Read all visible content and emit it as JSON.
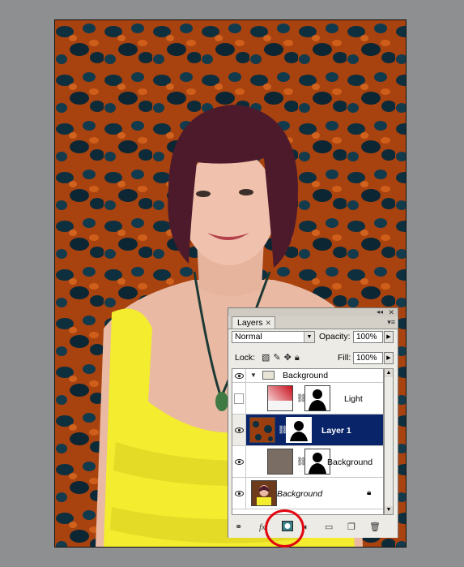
{
  "document": {
    "image_description_icon": "portrait-photo",
    "accent_red": "#e2060f"
  },
  "layers_panel": {
    "tab_label": "Layers",
    "blend_mode": "Normal",
    "opacity_label": "Opacity:",
    "opacity_value": "100%",
    "lock_label": "Lock:",
    "fill_label": "Fill:",
    "fill_value": "100%",
    "layers": [
      {
        "name": "Background",
        "type": "group",
        "visible": true
      },
      {
        "name": "Light",
        "type": "layer",
        "visible": false
      },
      {
        "name": "Layer 1",
        "type": "layer",
        "visible": true,
        "selected": true
      },
      {
        "name": "Background",
        "type": "layer",
        "visible": true
      },
      {
        "name": "Background",
        "type": "background",
        "visible": true,
        "locked": true
      }
    ],
    "selection_color": "#0a2469"
  }
}
